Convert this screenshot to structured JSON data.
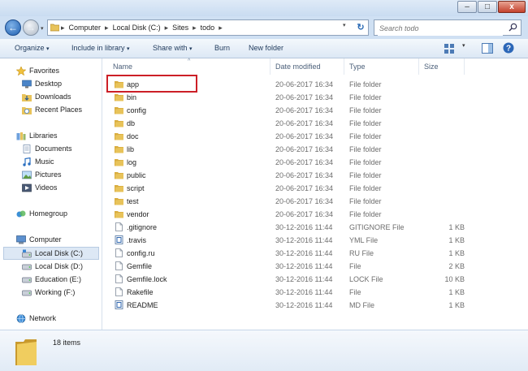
{
  "window": {
    "minimize": "–",
    "maximize": "□",
    "close": "x"
  },
  "nav": {
    "back": "←",
    "forward": "→",
    "breadcrumbs": [
      "Computer",
      "Local Disk (C:)",
      "Sites",
      "todo"
    ],
    "refresh": "↻",
    "search_placeholder": "Search todo"
  },
  "toolbar": {
    "organize": "Organize",
    "include": "Include in library",
    "share": "Share with",
    "burn": "Burn",
    "new_folder": "New folder"
  },
  "sidebar": {
    "favorites": "Favorites",
    "desktop": "Desktop",
    "downloads": "Downloads",
    "recent": "Recent Places",
    "libraries": "Libraries",
    "documents": "Documents",
    "music": "Music",
    "pictures": "Pictures",
    "videos": "Videos",
    "homegroup": "Homegroup",
    "computer": "Computer",
    "local_c": "Local Disk (C:)",
    "local_d": "Local Disk (D:)",
    "education": "Education (E:)",
    "working": "Working (F:)",
    "network": "Network"
  },
  "columns": {
    "name": "Name",
    "date": "Date modified",
    "type": "Type",
    "size": "Size"
  },
  "files": [
    {
      "name": "app",
      "date": "20-06-2017 16:34",
      "type": "File folder",
      "size": "",
      "kind": "folder"
    },
    {
      "name": "bin",
      "date": "20-06-2017 16:34",
      "type": "File folder",
      "size": "",
      "kind": "folder"
    },
    {
      "name": "config",
      "date": "20-06-2017 16:34",
      "type": "File folder",
      "size": "",
      "kind": "folder"
    },
    {
      "name": "db",
      "date": "20-06-2017 16:34",
      "type": "File folder",
      "size": "",
      "kind": "folder"
    },
    {
      "name": "doc",
      "date": "20-06-2017 16:34",
      "type": "File folder",
      "size": "",
      "kind": "folder"
    },
    {
      "name": "lib",
      "date": "20-06-2017 16:34",
      "type": "File folder",
      "size": "",
      "kind": "folder"
    },
    {
      "name": "log",
      "date": "20-06-2017 16:34",
      "type": "File folder",
      "size": "",
      "kind": "folder"
    },
    {
      "name": "public",
      "date": "20-06-2017 16:34",
      "type": "File folder",
      "size": "",
      "kind": "folder"
    },
    {
      "name": "script",
      "date": "20-06-2017 16:34",
      "type": "File folder",
      "size": "",
      "kind": "folder"
    },
    {
      "name": "test",
      "date": "20-06-2017 16:34",
      "type": "File folder",
      "size": "",
      "kind": "folder"
    },
    {
      "name": "vendor",
      "date": "20-06-2017 16:34",
      "type": "File folder",
      "size": "",
      "kind": "folder"
    },
    {
      "name": ".gitignore",
      "date": "30-12-2016 11:44",
      "type": "GITIGNORE File",
      "size": "1 KB",
      "kind": "file"
    },
    {
      "name": ".travis",
      "date": "30-12-2016 11:44",
      "type": "YML File",
      "size": "1 KB",
      "kind": "special"
    },
    {
      "name": "config.ru",
      "date": "30-12-2016 11:44",
      "type": "RU File",
      "size": "1 KB",
      "kind": "file"
    },
    {
      "name": "Gemfile",
      "date": "30-12-2016 11:44",
      "type": "File",
      "size": "2 KB",
      "kind": "file"
    },
    {
      "name": "Gemfile.lock",
      "date": "30-12-2016 11:44",
      "type": "LOCK File",
      "size": "10 KB",
      "kind": "file"
    },
    {
      "name": "Rakefile",
      "date": "30-12-2016 11:44",
      "type": "File",
      "size": "1 KB",
      "kind": "file"
    },
    {
      "name": "README",
      "date": "30-12-2016 11:44",
      "type": "MD File",
      "size": "1 KB",
      "kind": "special"
    }
  ],
  "status": {
    "count": "18 items"
  },
  "colors": {
    "folder": "#e8c35a",
    "highlight": "#cc1f27",
    "accent": "#1e395b"
  }
}
